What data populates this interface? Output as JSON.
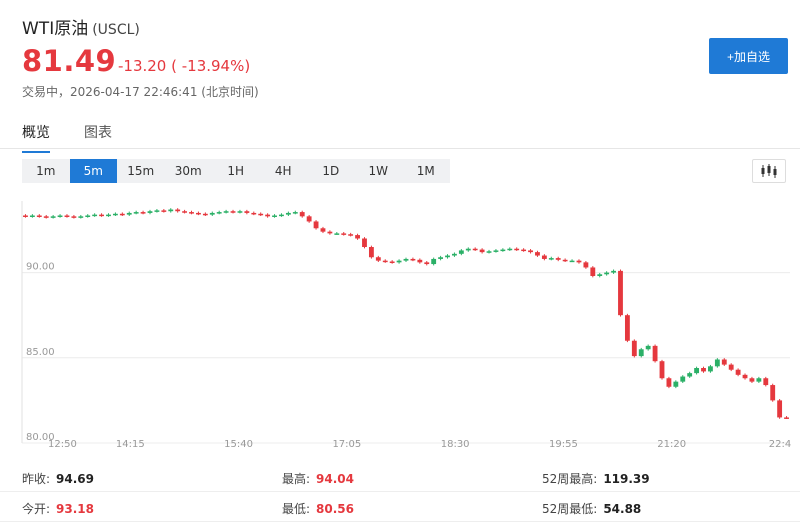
{
  "header": {
    "name": "WTI原油",
    "code": "(USCL)",
    "price": "81.49",
    "change": "-13.20 ( -13.94%)",
    "status": "交易中，2026-04-17 22:46:41 (北京时间)",
    "add_button": "+加自选"
  },
  "tabs": [
    "概览",
    "图表"
  ],
  "periods": [
    "1m",
    "5m",
    "15m",
    "30m",
    "1H",
    "4H",
    "1D",
    "1W",
    "1M"
  ],
  "active_period": "5m",
  "chart_type_icon": "candlestick-icon",
  "colors": {
    "up": "#2bb067",
    "down": "#e5383e",
    "accent": "#1f7ad6"
  },
  "stats": {
    "prev_close_label": "昨收:",
    "prev_close": "94.69",
    "high_label": "最高:",
    "high": "94.04",
    "high52_label": "52周最高:",
    "high52": "119.39",
    "open_label": "今开:",
    "open": "93.18",
    "low_label": "最低:",
    "low": "80.56",
    "low52_label": "52周最低:",
    "low52": "54.88"
  },
  "chart_data": {
    "type": "candlestick",
    "y_ticks": [
      "90.00",
      "85.00",
      "80.00"
    ],
    "x_ticks": [
      "12:50",
      "14:15",
      "15:40",
      "17:05",
      "18:30",
      "19:55",
      "21:20",
      "22:4"
    ],
    "ylim": [
      80.0,
      94.2
    ],
    "grid": true,
    "closes": [
      93.3,
      93.35,
      93.3,
      93.25,
      93.3,
      93.35,
      93.3,
      93.25,
      93.3,
      93.35,
      93.4,
      93.35,
      93.4,
      93.45,
      93.4,
      93.5,
      93.55,
      93.5,
      93.6,
      93.65,
      93.6,
      93.7,
      93.6,
      93.55,
      93.5,
      93.45,
      93.4,
      93.5,
      93.55,
      93.6,
      93.55,
      93.6,
      93.5,
      93.45,
      93.4,
      93.3,
      93.35,
      93.4,
      93.5,
      93.55,
      93.3,
      93.0,
      92.6,
      92.4,
      92.3,
      92.3,
      92.25,
      92.2,
      92.0,
      91.5,
      90.9,
      90.7,
      90.65,
      90.6,
      90.7,
      90.8,
      90.75,
      90.6,
      90.5,
      90.8,
      90.9,
      91.0,
      91.1,
      91.3,
      91.4,
      91.35,
      91.2,
      91.25,
      91.3,
      91.35,
      91.4,
      91.35,
      91.3,
      91.2,
      91.0,
      90.8,
      90.85,
      90.75,
      90.7,
      90.7,
      90.6,
      90.3,
      89.8,
      89.9,
      90.0,
      90.1,
      87.5,
      86.0,
      85.1,
      85.5,
      85.7,
      84.8,
      83.8,
      83.3,
      83.6,
      83.9,
      84.1,
      84.4,
      84.2,
      84.5,
      84.9,
      84.6,
      84.3,
      84.0,
      83.8,
      83.6,
      83.8,
      83.4,
      82.5,
      81.5,
      81.49
    ]
  }
}
